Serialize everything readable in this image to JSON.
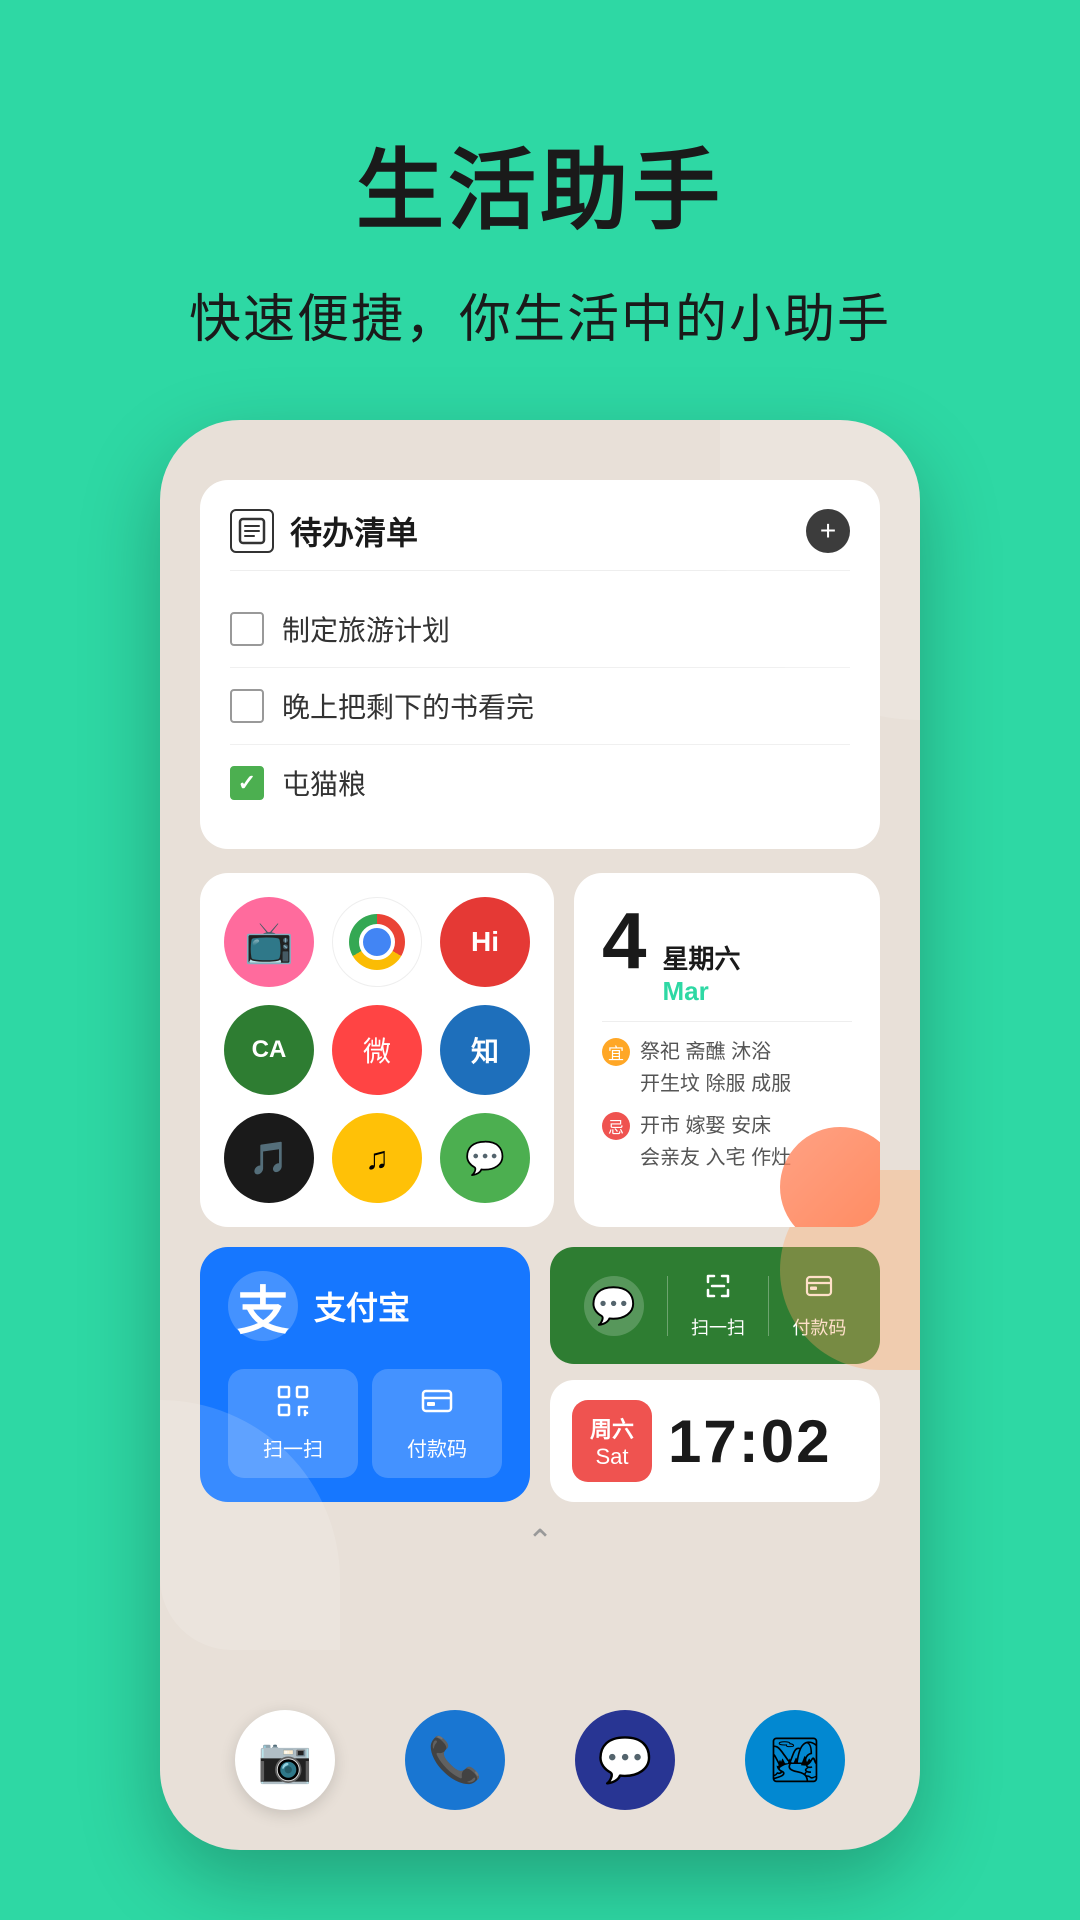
{
  "header": {
    "title": "生活助手",
    "subtitle": "快速便捷，你生活中的小助手"
  },
  "todo": {
    "widget_title": "待办清单",
    "items": [
      {
        "text": "制定旅游计划",
        "checked": false
      },
      {
        "text": "晚上把剩下的书看完",
        "checked": false
      },
      {
        "text": "屯猫粮",
        "checked": true
      }
    ],
    "add_button_label": "+"
  },
  "apps": [
    {
      "name": "tv-app",
      "color": "pink",
      "emoji": "📺"
    },
    {
      "name": "chrome",
      "color": "chrome",
      "emoji": ""
    },
    {
      "name": "hi-app",
      "color": "hi",
      "emoji": "🔵"
    },
    {
      "name": "ca-app",
      "color": "green",
      "emoji": "🟢"
    },
    {
      "name": "weibo",
      "color": "weibo",
      "emoji": "微"
    },
    {
      "name": "zhihu",
      "color": "zhihu",
      "emoji": "知"
    },
    {
      "name": "tiktok",
      "color": "tiktok",
      "emoji": "♪"
    },
    {
      "name": "music",
      "color": "music",
      "emoji": "♫"
    },
    {
      "name": "wechat",
      "color": "wechat",
      "emoji": "💬"
    }
  ],
  "calendar": {
    "day": "4",
    "weekday": "星期六",
    "month": "Mar",
    "good_activities": "祭祀 斋醮 沐浴\n开生坟 除服 成服",
    "bad_activities": "开市 嫁娶 安床\n会亲友 入宅 作灶"
  },
  "alipay": {
    "char": "支",
    "name": "支付宝",
    "actions": [
      {
        "icon": "⬜",
        "text": "扫一扫"
      },
      {
        "icon": "💳",
        "text": "付款码"
      }
    ]
  },
  "wechat_widget": {
    "scan_label": "扫一扫",
    "pay_label": "付款码"
  },
  "clock": {
    "weekday": "周六",
    "dayname": "Sat",
    "time": "17:02"
  },
  "dock": [
    {
      "name": "camera",
      "emoji": "📷",
      "color": "white"
    },
    {
      "name": "phone",
      "emoji": "📞",
      "color": "#1976D2"
    },
    {
      "name": "message",
      "emoji": "💬",
      "color": "#283593"
    },
    {
      "name": "gallery",
      "emoji": "🏞",
      "color": "#0288D1"
    }
  ]
}
